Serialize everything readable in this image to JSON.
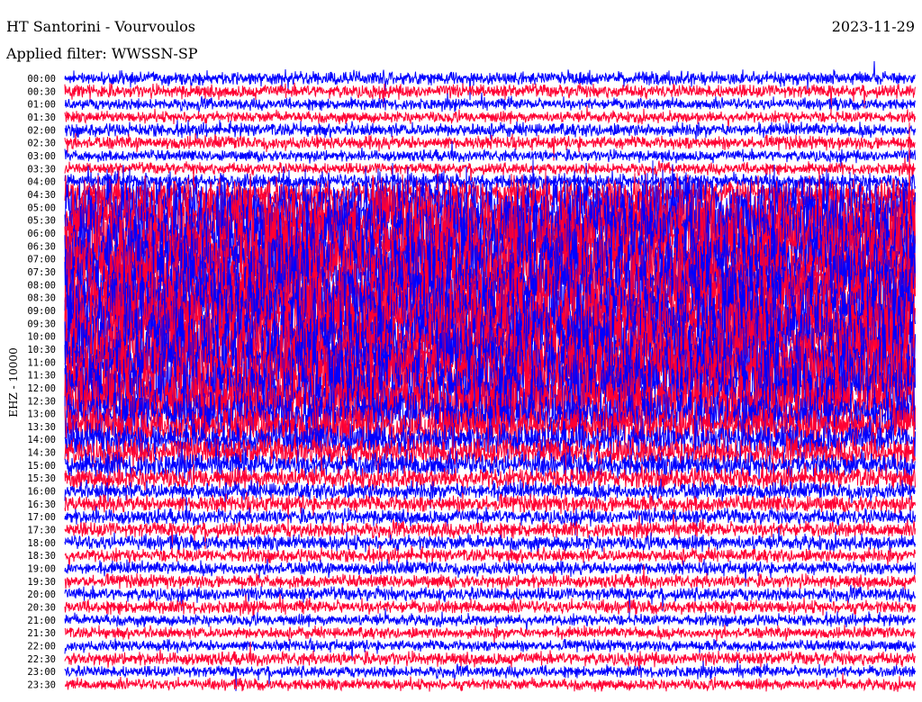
{
  "header": {
    "title": "HT Santorini - Vourvoulos",
    "filter": "Applied filter: WWSSN-SP",
    "date": "2023-11-29"
  },
  "chart_data": {
    "type": "line",
    "title": "HT Santorini - Vourvoulos",
    "subtitle": "Applied filter: WWSSN-SP",
    "ylabel": "EHZ - 10000",
    "xlabel": "",
    "colors": [
      "#0000ff",
      "#ff0033"
    ],
    "row_labels": [
      "00:00",
      "00:30",
      "01:00",
      "01:30",
      "02:00",
      "02:30",
      "03:00",
      "03:30",
      "04:00",
      "04:30",
      "05:00",
      "05:30",
      "06:00",
      "06:30",
      "07:00",
      "07:30",
      "08:00",
      "08:30",
      "09:00",
      "09:30",
      "10:00",
      "10:30",
      "11:00",
      "11:30",
      "12:00",
      "12:30",
      "13:00",
      "13:30",
      "14:00",
      "14:30",
      "15:00",
      "15:30",
      "16:00",
      "16:30",
      "17:00",
      "17:30",
      "18:00",
      "18:30",
      "19:00",
      "19:30",
      "20:00",
      "20:30",
      "21:00",
      "21:30",
      "22:00",
      "22:30",
      "23:00",
      "23:30"
    ],
    "relative_amplitude": [
      0.7,
      0.7,
      0.6,
      0.6,
      0.7,
      0.7,
      0.6,
      0.6,
      0.8,
      1.5,
      3.5,
      4,
      4,
      4,
      4,
      4,
      4,
      4,
      4,
      4,
      4,
      4,
      4,
      3.8,
      3.5,
      3.2,
      2.5,
      2.2,
      1.8,
      1.5,
      1.3,
      1.1,
      0.9,
      0.9,
      0.8,
      0.8,
      0.8,
      0.7,
      0.7,
      0.7,
      0.7,
      0.7,
      0.6,
      0.6,
      0.6,
      0.7,
      0.6,
      0.6
    ]
  }
}
